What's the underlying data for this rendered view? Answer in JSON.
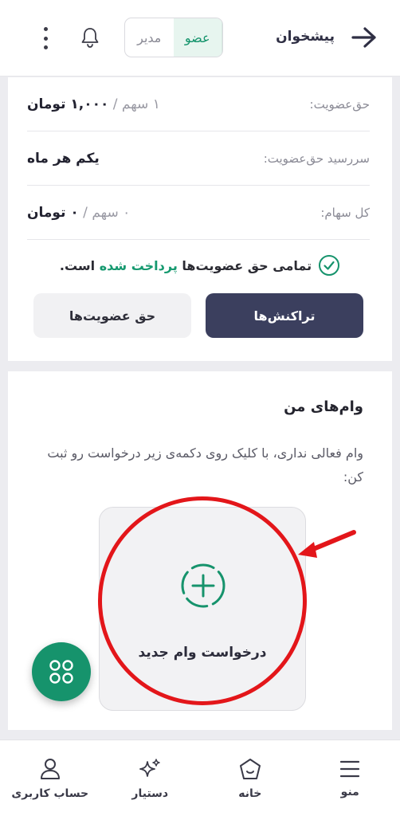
{
  "header": {
    "title": "پیشخوان",
    "role_manager": "مدیر",
    "role_member": "عضو",
    "back_icon": "arrow-right-icon",
    "bell_icon": "bell-icon",
    "more_icon": "more-vertical-icon"
  },
  "membership": {
    "rows": [
      {
        "label": "حق‌عضویت:",
        "value_muted": "۱ سهم / ",
        "value_main": "۱,۰۰۰ تومان"
      },
      {
        "label": "سررسید حق‌عضویت:",
        "value_muted": "",
        "value_main": "یکم هر ماه"
      },
      {
        "label": "کل سهام:",
        "value_muted": "۰ سهم / ",
        "value_main": "۰ تومان"
      }
    ],
    "paid_prefix": "تمامی حق عضویت‌ها",
    "paid_highlight": "پرداخت شده",
    "paid_suffix": "است.",
    "btn_transactions": "تراکنش‌ها",
    "btn_memberships": "حق عضویت‌ها"
  },
  "loans": {
    "title": "وام‌های من",
    "description": "وام فعالی نداری، با کلیک روی دکمه‌ی زیر درخواست رو ثبت کن:",
    "new_loan_label": "درخواست وام جدید"
  },
  "nav": {
    "menu": "منو",
    "home": "خانه",
    "assistant": "دستیار",
    "account": "حساب کاربری"
  },
  "colors": {
    "accent_green": "#16936c",
    "dark_button": "#3b3f5e",
    "annotation_red": "#e3161a"
  }
}
